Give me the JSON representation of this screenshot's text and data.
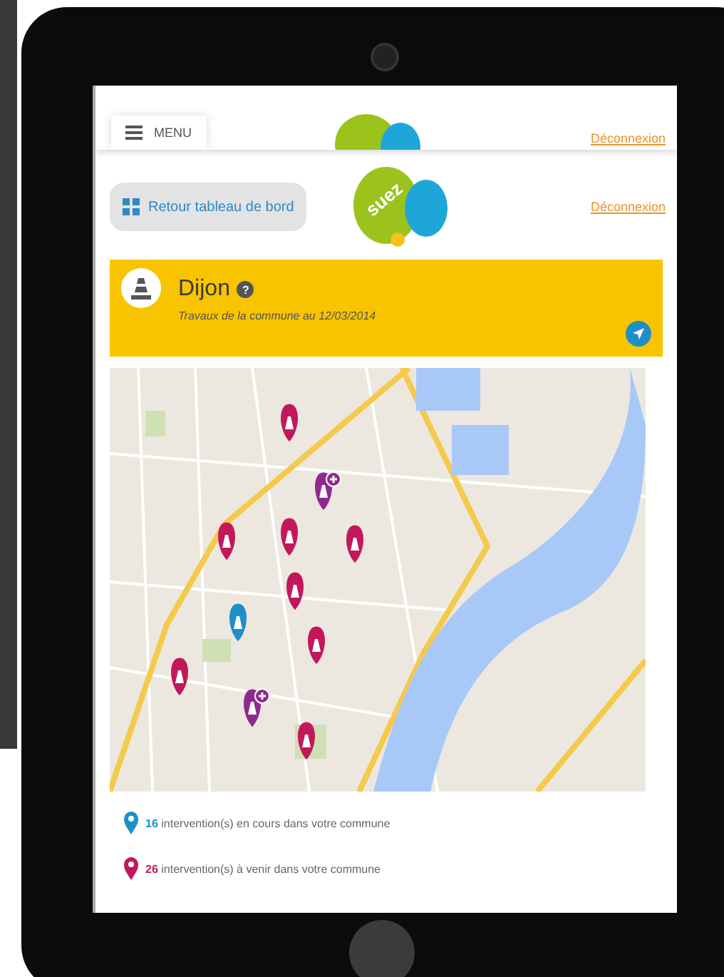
{
  "top_bar": {
    "menu_label": "MENU",
    "logout": "Déconnexion"
  },
  "header": {
    "back_button": "Retour tableau de bord",
    "logo_text": "suez",
    "logout": "Déconnexion"
  },
  "banner": {
    "title": "Dijon",
    "help": "?",
    "subtitle": "Travaux de la commune au 12/03/2014"
  },
  "legend": [
    {
      "count": "16",
      "text": "intervention(s) en cours dans votre commune",
      "color": "#1e8fc8"
    },
    {
      "count": "26",
      "text": "intervention(s) à venir dans votre commune",
      "color": "#c2185b"
    }
  ]
}
